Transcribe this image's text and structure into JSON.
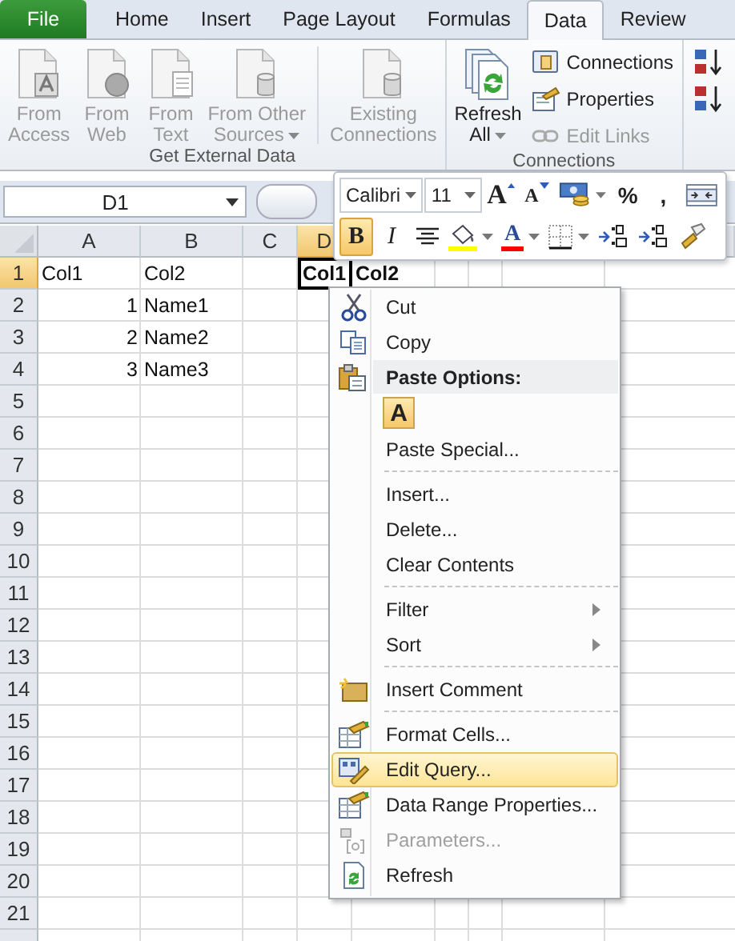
{
  "tabs": [
    {
      "label": "File",
      "kind": "file",
      "selected": false
    },
    {
      "label": "Home",
      "kind": "tab",
      "selected": false
    },
    {
      "label": "Insert",
      "kind": "tab",
      "selected": false
    },
    {
      "label": "Page Layout",
      "kind": "tab",
      "selected": false
    },
    {
      "label": "Formulas",
      "kind": "tab",
      "selected": false
    },
    {
      "label": "Data",
      "kind": "tab",
      "selected": true
    },
    {
      "label": "Review",
      "kind": "tab",
      "selected": false
    }
  ],
  "ribbon": {
    "groups": [
      {
        "label": "Get External Data",
        "buttons": [
          {
            "kind": "large",
            "lines": [
              "From",
              "Access"
            ],
            "disabled": true,
            "dropdown": false
          },
          {
            "kind": "large",
            "lines": [
              "From",
              "Web"
            ],
            "disabled": true,
            "dropdown": false
          },
          {
            "kind": "large",
            "lines": [
              "From",
              "Text"
            ],
            "disabled": true,
            "dropdown": false
          },
          {
            "kind": "large",
            "lines": [
              "From Other",
              "Sources"
            ],
            "disabled": true,
            "dropdown": true
          },
          {
            "kind": "separator"
          },
          {
            "kind": "large",
            "lines": [
              "Existing",
              "Connections"
            ],
            "disabled": true,
            "dropdown": false
          }
        ]
      },
      {
        "label": "Connections",
        "buttons": [
          {
            "kind": "large",
            "lines": [
              "Refresh",
              "All"
            ],
            "disabled": false,
            "dropdown": true
          },
          {
            "kind": "small",
            "label": "Connections",
            "disabled": false
          },
          {
            "kind": "small",
            "label": "Properties",
            "disabled": false
          },
          {
            "kind": "small",
            "label": "Edit Links",
            "disabled": true
          }
        ]
      },
      {
        "buttons": [
          {
            "kind": "small"
          },
          {
            "kind": "small"
          }
        ]
      }
    ]
  },
  "formula_bar": {
    "name_box": "D1"
  },
  "sheet": {
    "columns": [
      {
        "label": "A",
        "selected": false
      },
      {
        "label": "B",
        "selected": false
      },
      {
        "label": "C",
        "selected": false
      },
      {
        "label": "D",
        "selected": true
      }
    ],
    "rows": [
      {
        "number": "1",
        "selected": true,
        "cells": [
          {
            "kind": "text",
            "text": "Col1",
            "bold": false,
            "active": false
          },
          {
            "kind": "text",
            "text": "Col2",
            "bold": false,
            "active": false
          },
          {
            "kind": "empty"
          },
          {
            "kind": "text",
            "text": "Col1",
            "bold": true,
            "active": true
          },
          {
            "kind": "text",
            "text": "Col2",
            "bold": true,
            "active": false
          }
        ]
      },
      {
        "number": "2",
        "selected": false,
        "cells": [
          {
            "kind": "number",
            "text": "1",
            "bold": false,
            "active": false
          },
          {
            "kind": "text",
            "text": "Name1",
            "bold": false,
            "active": false
          }
        ]
      },
      {
        "number": "3",
        "selected": false,
        "cells": [
          {
            "kind": "number",
            "text": "2",
            "bold": false,
            "active": false
          },
          {
            "kind": "text",
            "text": "Name2",
            "bold": false,
            "active": false
          }
        ]
      },
      {
        "number": "4",
        "selected": false,
        "cells": [
          {
            "kind": "number",
            "text": "3",
            "bold": false,
            "active": false
          },
          {
            "kind": "text",
            "text": "Name3",
            "bold": false,
            "active": false
          }
        ]
      },
      {
        "number": "5",
        "selected": false
      },
      {
        "number": "6",
        "selected": false
      },
      {
        "number": "7",
        "selected": false
      },
      {
        "number": "8",
        "selected": false
      },
      {
        "number": "9",
        "selected": false
      },
      {
        "number": "10",
        "selected": false
      },
      {
        "number": "11",
        "selected": false
      },
      {
        "number": "12",
        "selected": false
      },
      {
        "number": "13",
        "selected": false
      },
      {
        "number": "14",
        "selected": false
      },
      {
        "number": "15",
        "selected": false
      },
      {
        "number": "16",
        "selected": false
      },
      {
        "number": "17",
        "selected": false
      },
      {
        "number": "18",
        "selected": false
      },
      {
        "number": "19",
        "selected": false
      },
      {
        "number": "20",
        "selected": false
      },
      {
        "number": "21",
        "selected": false
      }
    ]
  },
  "mini_toolbar": {
    "top_row": [
      {
        "kind": "combo",
        "value": "Calibri"
      },
      {
        "kind": "combo",
        "value": "11"
      },
      {
        "kind": "grow",
        "label": "A",
        "selected": false,
        "dropdown": false
      },
      {
        "kind": "shrink",
        "label": "A",
        "selected": false,
        "dropdown": false
      },
      {
        "kind": "icon",
        "selected": false,
        "dropdown": true
      },
      {
        "kind": "symbol",
        "label": "%",
        "selected": false,
        "dropdown": false
      },
      {
        "kind": "symbol",
        "label": ",",
        "selected": false,
        "dropdown": false
      },
      {
        "kind": "icon",
        "selected": false,
        "dropdown": false
      }
    ],
    "bottom_row": [
      {
        "kind": "bold",
        "label": "B",
        "selected": true,
        "dropdown": false
      },
      {
        "kind": "italic",
        "label": "I",
        "selected": false,
        "dropdown": false
      },
      {
        "kind": "icon",
        "selected": false,
        "dropdown": false
      },
      {
        "kind": "icon",
        "selected": false,
        "dropdown": true,
        "color": "#ffff00"
      },
      {
        "kind": "font-color",
        "label": "A",
        "selected": false,
        "dropdown": true,
        "color": "#ff0000"
      },
      {
        "kind": "icon",
        "selected": false,
        "dropdown": true
      },
      {
        "kind": "icon",
        "selected": false,
        "dropdown": false
      },
      {
        "kind": "icon",
        "selected": false,
        "dropdown": false
      },
      {
        "kind": "icon",
        "selected": false,
        "dropdown": false
      }
    ]
  },
  "context_menu": {
    "items": [
      {
        "kind": "item",
        "label": "Cut",
        "disabled": false,
        "selected": false,
        "submenu": false
      },
      {
        "kind": "item",
        "label": "Copy",
        "disabled": false,
        "selected": false,
        "submenu": false
      },
      {
        "kind": "header",
        "label": "Paste Options:"
      },
      {
        "kind": "paste",
        "label": "A"
      },
      {
        "kind": "item",
        "label": "Paste Special...",
        "disabled": false,
        "selected": false,
        "submenu": false
      },
      {
        "kind": "separator"
      },
      {
        "kind": "item",
        "label": "Insert...",
        "disabled": false,
        "selected": false,
        "submenu": false
      },
      {
        "kind": "item",
        "label": "Delete...",
        "disabled": false,
        "selected": false,
        "submenu": false
      },
      {
        "kind": "item",
        "label": "Clear Contents",
        "disabled": false,
        "selected": false,
        "submenu": false
      },
      {
        "kind": "separator"
      },
      {
        "kind": "item",
        "label": "Filter",
        "disabled": false,
        "selected": false,
        "submenu": true
      },
      {
        "kind": "item",
        "label": "Sort",
        "disabled": false,
        "selected": false,
        "submenu": true
      },
      {
        "kind": "separator"
      },
      {
        "kind": "item",
        "label": "Insert Comment",
        "disabled": false,
        "selected": false,
        "submenu": false
      },
      {
        "kind": "separator"
      },
      {
        "kind": "item",
        "label": "Format Cells...",
        "disabled": false,
        "selected": false,
        "submenu": false
      },
      {
        "kind": "item",
        "label": "Edit Query...",
        "disabled": false,
        "selected": true,
        "submenu": false
      },
      {
        "kind": "item",
        "label": "Data Range Properties...",
        "disabled": false,
        "selected": false,
        "submenu": false
      },
      {
        "kind": "item",
        "label": "Parameters...",
        "disabled": true,
        "selected": false,
        "submenu": false
      },
      {
        "kind": "item",
        "label": "Refresh",
        "disabled": false,
        "selected": false,
        "submenu": false
      }
    ]
  }
}
